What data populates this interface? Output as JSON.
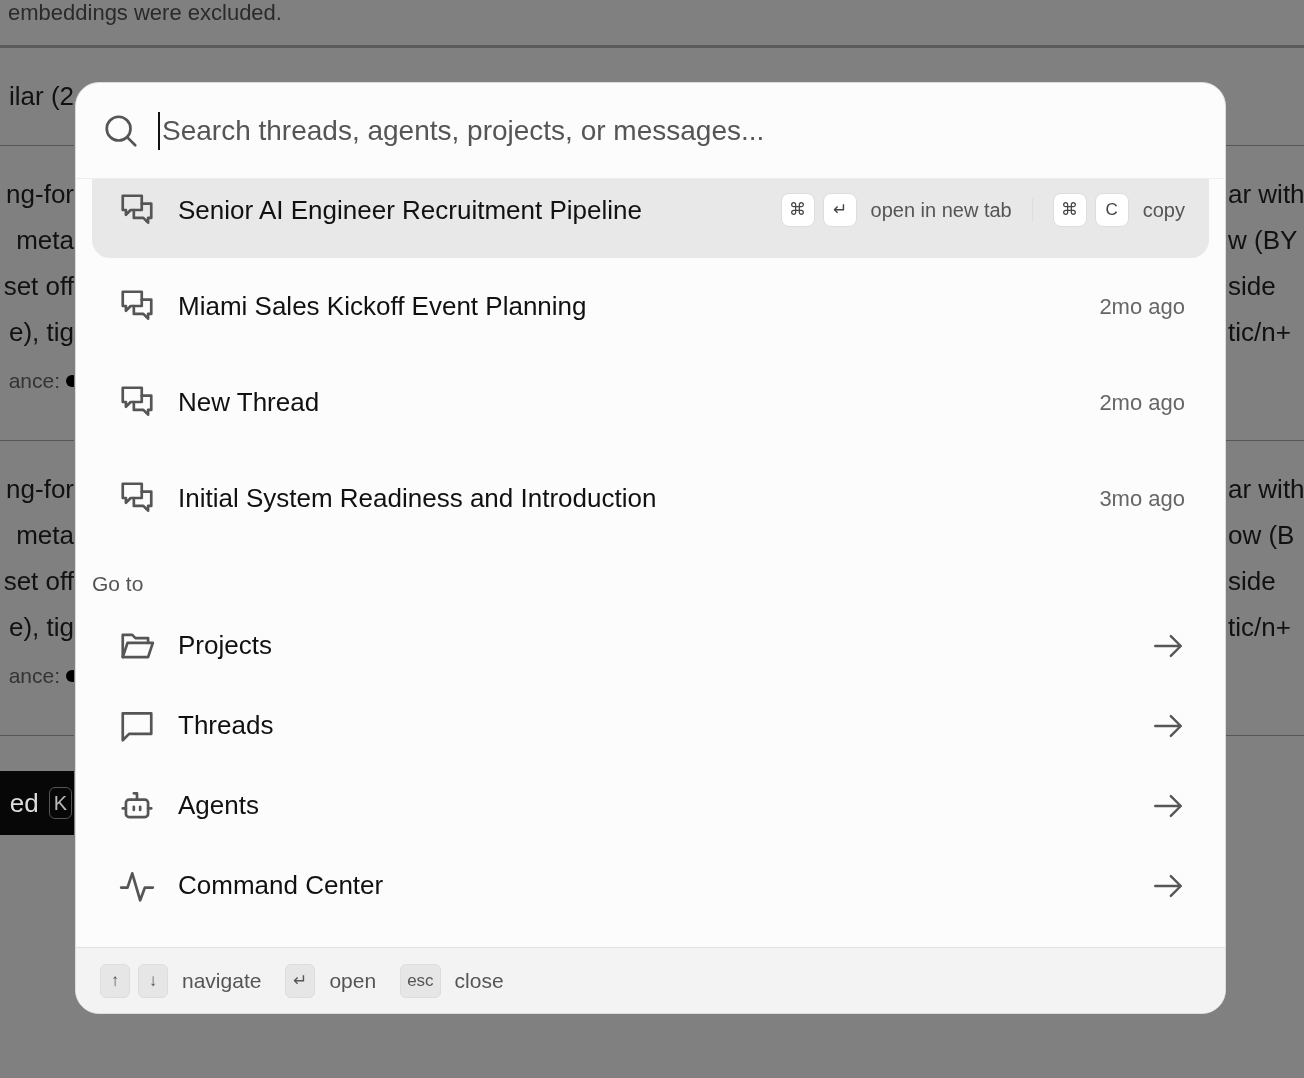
{
  "background": {
    "top_text": "embeddings were excluded.",
    "heading": "ilar (2",
    "sections": [
      {
        "left_lines": [
          "ng-for",
          "meta",
          "set off",
          "e), tig"
        ],
        "left_meta": "ance:",
        "right_lines": [
          "ar with",
          "w (BY",
          "side",
          "tic/n+"
        ]
      },
      {
        "left_lines": [
          "ng-for",
          "meta",
          "set off",
          "e), tig"
        ],
        "left_meta": "ance:",
        "right_lines": [
          "ar with",
          "ow (B",
          "side",
          "tic/n+"
        ]
      }
    ],
    "banner": {
      "text": "ed",
      "key": "K"
    }
  },
  "palette": {
    "search": {
      "placeholder": "Search threads, agents, projects, or messages..."
    },
    "threads": [
      {
        "title": "Senior AI Engineer Recruitment Pipeline",
        "selected": true,
        "actions": [
          {
            "keys": [
              "⌘",
              "↵"
            ],
            "label": "open in new tab"
          },
          {
            "keys": [
              "⌘",
              "C"
            ],
            "label": "copy"
          }
        ]
      },
      {
        "title": "Miami Sales Kickoff Event Planning",
        "selected": false,
        "time": "2mo ago"
      },
      {
        "title": "New Thread",
        "selected": false,
        "time": "2mo ago"
      },
      {
        "title": "Initial System Readiness and Introduction",
        "selected": false,
        "time": "3mo ago"
      }
    ],
    "goto": {
      "title": "Go to",
      "items": [
        {
          "label": "Projects",
          "kind": "folder"
        },
        {
          "label": "Threads",
          "kind": "chat"
        },
        {
          "label": "Agents",
          "kind": "robot"
        },
        {
          "label": "Command Center",
          "kind": "pulse"
        }
      ]
    },
    "footer": [
      {
        "keys": [
          "↑",
          "↓"
        ],
        "label": "navigate"
      },
      {
        "keys": [
          "↵"
        ],
        "label": "open"
      },
      {
        "keys": [
          "esc"
        ],
        "label": "close"
      }
    ]
  }
}
